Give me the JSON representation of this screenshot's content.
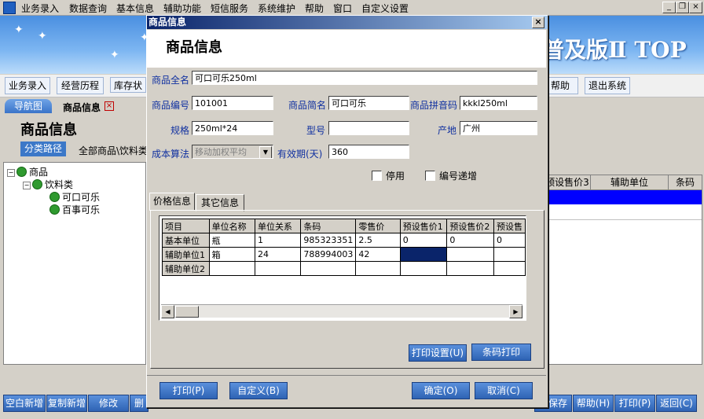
{
  "menubar": {
    "items": [
      "业务录入",
      "数据查询",
      "基本信息",
      "辅助功能",
      "短信服务",
      "系统维护",
      "帮助",
      "窗口",
      "自定义设置"
    ],
    "minimize": "_",
    "restore": "❐",
    "close": "×"
  },
  "banner": {
    "title": "普及版Ⅱ TOP"
  },
  "toolbar": {
    "items": [
      "业务录入",
      "经营历程",
      "库存状",
      "帮助",
      "退出系统"
    ]
  },
  "tabs": {
    "nav": "导航图",
    "current": "商品信息",
    "close": "×"
  },
  "main": {
    "title": "商品信息",
    "category_path_btn": "分类路径",
    "all_goods": "全部商品\\饮料类"
  },
  "tree": {
    "root": "商品",
    "child": "饮料类",
    "leaves": [
      "可口可乐",
      "百事可乐"
    ]
  },
  "right_grid": {
    "headers": [
      "预设售价3",
      "辅助单位",
      "条码"
    ]
  },
  "bottom_buttons": {
    "left": [
      "空白新增",
      "复制新增",
      "修改",
      "删"
    ],
    "right": [
      "存保存",
      "帮助(H)",
      "打印(P)",
      "返回(C)"
    ]
  },
  "dialog": {
    "title": "商品信息",
    "close": "×",
    "heading": "商品信息",
    "labels": {
      "full_name": "商品全名",
      "code": "商品编号",
      "short_name": "商品简名",
      "pinyin": "商品拼音码",
      "spec": "规格",
      "model": "型号",
      "origin": "产地",
      "cost_method": "成本算法",
      "validity": "有效期(天)",
      "disabled": "停用",
      "auto_increment": "编号递增"
    },
    "values": {
      "full_name": "可口可乐250ml",
      "code": "101001",
      "short_name": "可口可乐",
      "pinyin": "kkkl250ml",
      "spec": "250ml*24",
      "model": "",
      "origin": "广州",
      "cost_method": "移动加权平均",
      "validity": "360"
    },
    "tabs": [
      "价格信息",
      "其它信息"
    ],
    "price_table": {
      "headers": [
        "项目",
        "单位名称",
        "单位关系",
        "条码",
        "零售价",
        "预设售价1",
        "预设售价2",
        "预设售"
      ],
      "rows": [
        [
          "基本单位",
          "瓶",
          "1",
          "985323351",
          "2.5",
          "0",
          "0",
          "0"
        ],
        [
          "辅助单位1",
          "箱",
          "24",
          "788994003",
          "42",
          "",
          "",
          ""
        ],
        [
          "辅助单位2",
          "",
          "",
          "",
          "",
          "",
          "",
          ""
        ]
      ]
    },
    "print_settings_btn": "打印设置(U)",
    "barcode_print_btn": "条码打印",
    "footer": {
      "print": "打印(P)",
      "customize": "自定义(B)",
      "ok": "确定(O)",
      "cancel": "取消(C)"
    }
  }
}
